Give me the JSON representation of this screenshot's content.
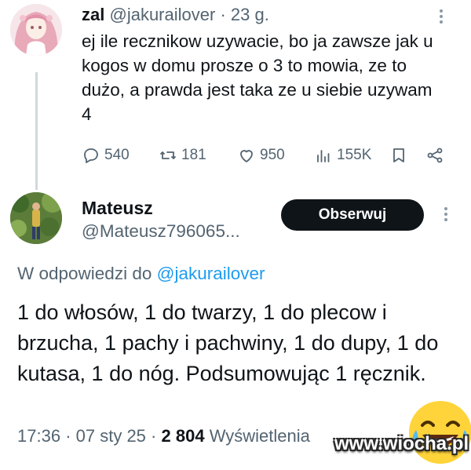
{
  "tweet1": {
    "display_name": "zal",
    "handle": "@jakurailover",
    "separator": "·",
    "time_ago": "23 g.",
    "text": "ej ile recznikow uzywacie, bo ja zawsze jak u kogos w domu prosze o 3 to mowia, ze to dużo, a prawda jest taka ze u siebie uzywam 4",
    "actions": {
      "replies": "540",
      "reposts": "181",
      "likes": "950",
      "views": "155K"
    }
  },
  "tweet2": {
    "display_name": "Mateusz",
    "handle": "@Mateusz796065...",
    "follow_label": "Obserwuj",
    "reply_prefix": "W odpowiedzi do",
    "reply_to": "@jakurailover",
    "text": "1 do włosów, 1 do twarzy, 1 do plecow i brzucha, 1 pachy i pachwiny, 1 do dupy, 1 do kutasa, 1 do nóg. Podsumowując 1 ręcznik.",
    "time": "17:36",
    "date": "07 sty 25",
    "views_count": "2 804",
    "views_label": "Wyświetlenia"
  },
  "watermark": "www.wiocha.pl",
  "icons": {
    "reply": "reply-icon",
    "repost": "repost-icon",
    "like": "heart-icon",
    "views": "views-icon",
    "bookmark": "bookmark-icon",
    "share": "share-icon",
    "more": "more-icon",
    "emoji": "laughing-crying-emoji-icon"
  },
  "colors": {
    "text": "#0f1419",
    "muted": "#536471",
    "link": "#1d9bf0",
    "button_bg": "#0f1419"
  }
}
